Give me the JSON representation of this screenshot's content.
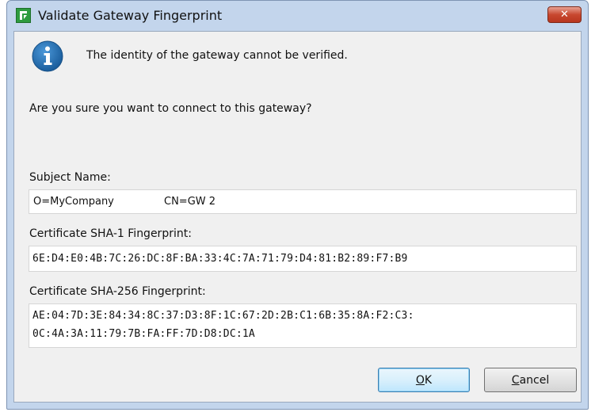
{
  "window": {
    "title": "Validate Gateway Fingerprint",
    "close_label": "✕"
  },
  "message": {
    "info": "The identity of the gateway cannot be verified.",
    "question": "Are you sure you want to connect to this gateway?"
  },
  "subject": {
    "label": "Subject Name:",
    "org": "O=MyCompany",
    "cn": "CN=GW 2"
  },
  "sha1": {
    "label": "Certificate SHA-1 Fingerprint:",
    "value": "6E:D4:E0:4B:7C:26:DC:8F:BA:33:4C:7A:71:79:D4:81:B2:89:F7:B9"
  },
  "sha256": {
    "label": "Certificate SHA-256 Fingerprint:",
    "line1": "AE:04:7D:3E:84:34:8C:37:D3:8F:1C:67:2D:2B:C1:6B:35:8A:F2:C3:",
    "line2": "0C:4A:3A:11:79:7B:FA:FF:7D:D8:DC:1A"
  },
  "buttons": {
    "ok_mnemonic": "O",
    "ok_rest": "K",
    "cancel_mnemonic": "C",
    "cancel_rest": "ancel"
  },
  "icons": {
    "app": "app-icon",
    "info": "info-icon",
    "close": "close-icon"
  },
  "colors": {
    "app_icon": "#2e9b3f",
    "info_icon": "#1f6fb2",
    "close_button": "#c8482f",
    "ok_border": "#3c7fb1"
  }
}
